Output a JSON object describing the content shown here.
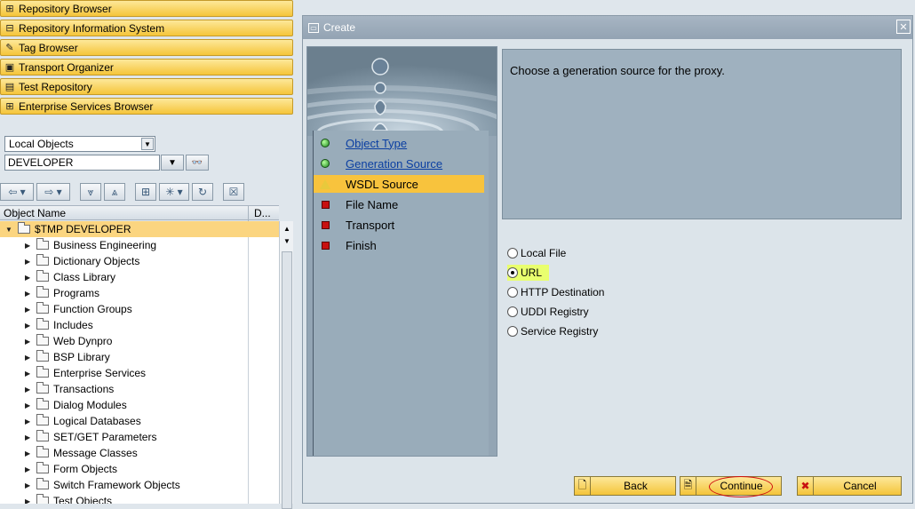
{
  "nav": [
    {
      "label": "Repository Browser",
      "icon": "hierarchy-icon",
      "glyph": "⊞"
    },
    {
      "label": "Repository Information System",
      "icon": "tree-structure-icon",
      "glyph": "⊟"
    },
    {
      "label": "Tag Browser",
      "icon": "tag-browser-icon",
      "glyph": "✎"
    },
    {
      "label": "Transport Organizer",
      "icon": "truck-icon",
      "glyph": "▣"
    },
    {
      "label": "Test Repository",
      "icon": "test-repository-icon",
      "glyph": "▤"
    },
    {
      "label": "Enterprise Services Browser",
      "icon": "services-icon",
      "glyph": "⊞"
    }
  ],
  "object_selector": {
    "selected": "Local Objects",
    "user": "DEVELOPER"
  },
  "grid": {
    "col_object_name": "Object Name",
    "col_d": "D..."
  },
  "tree": {
    "root": "$TMP DEVELOPER",
    "items": [
      "Business Engineering",
      "Dictionary Objects",
      "Class Library",
      "Programs",
      "Function Groups",
      "Includes",
      "Web Dynpro",
      "BSP Library",
      "Enterprise Services",
      "Transactions",
      "Dialog Modules",
      "Logical Databases",
      "SET/GET Parameters",
      "Message Classes",
      "Form Objects",
      "Switch Framework Objects",
      "Test Objects"
    ]
  },
  "dialog": {
    "title": "Create",
    "close": "✕",
    "steps": [
      {
        "label": "Object Type",
        "status": "done"
      },
      {
        "label": "Generation Source",
        "status": "done"
      },
      {
        "label": "WSDL Source",
        "status": "current"
      },
      {
        "label": "File Name",
        "status": "pending"
      },
      {
        "label": "Transport",
        "status": "pending"
      },
      {
        "label": "Finish",
        "status": "pending"
      }
    ],
    "info_text": "Choose a generation source for the proxy.",
    "options": [
      {
        "label": "Local File",
        "selected": false
      },
      {
        "label": "URL",
        "selected": true
      },
      {
        "label": "HTTP Destination",
        "selected": false
      },
      {
        "label": "UDDI Registry",
        "selected": false
      },
      {
        "label": "Service Registry",
        "selected": false
      }
    ],
    "buttons": {
      "back": "Back",
      "continue": "Continue",
      "cancel": "Cancel"
    }
  },
  "colors": {
    "nav_yellow": "#f5c53a",
    "active_step": "#f8c33d",
    "highlight": "#e9ff6e",
    "annotation_red": "#d01010"
  }
}
